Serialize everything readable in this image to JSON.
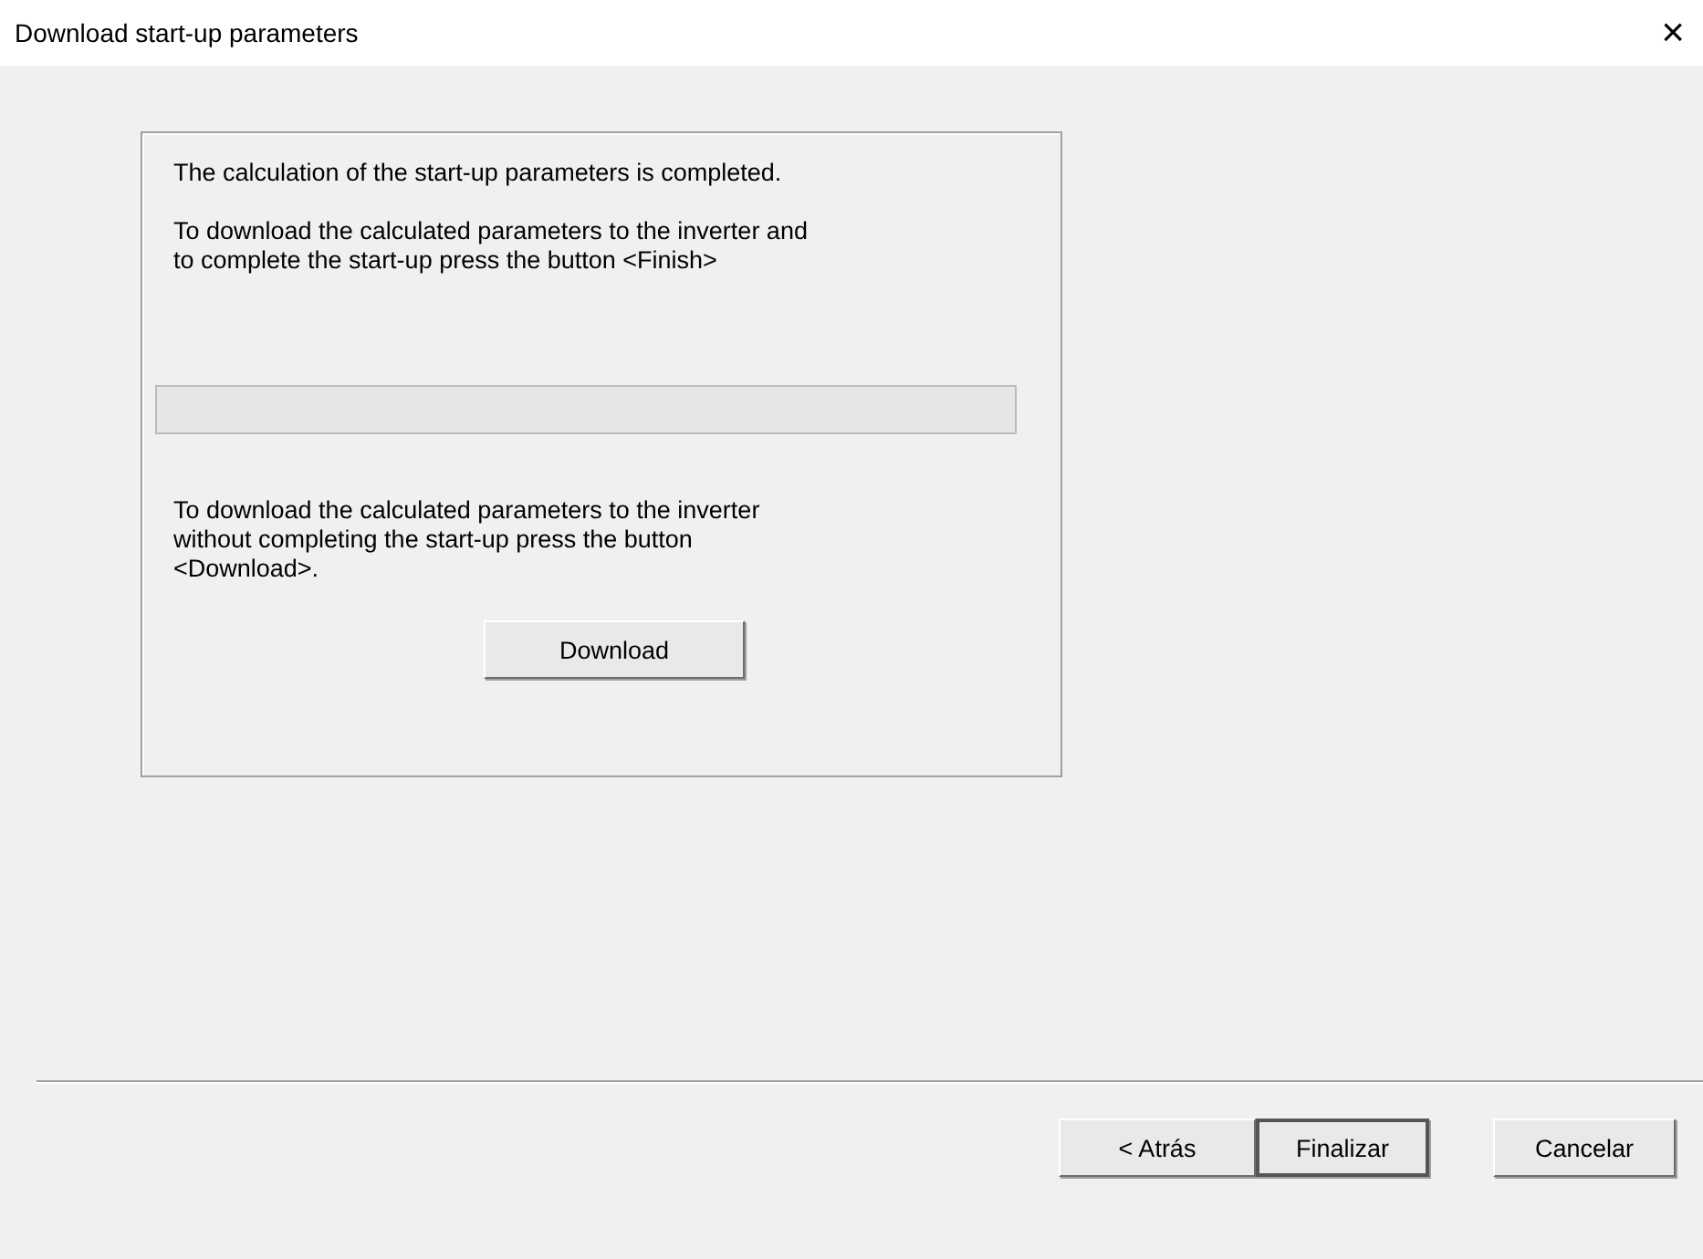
{
  "window": {
    "title": "Download start-up parameters",
    "close": "×"
  },
  "group": {
    "status_text": "The calculation of the start-up parameters is completed.",
    "finish_text": "To download the calculated parameters to the inverter and\nto complete the start-up press the button <Finish>",
    "progress": {
      "level": 0
    },
    "download_text": "To download the calculated parameters to the inverter\nwithout completing the start-up press the button\n<Download>.",
    "download_button": "Download"
  },
  "buttons": [
    {
      "label": "< Atrás",
      "default": false
    },
    {
      "label": "Finalizar",
      "default": true
    },
    {
      "label": "Cancelar",
      "default": false
    }
  ]
}
